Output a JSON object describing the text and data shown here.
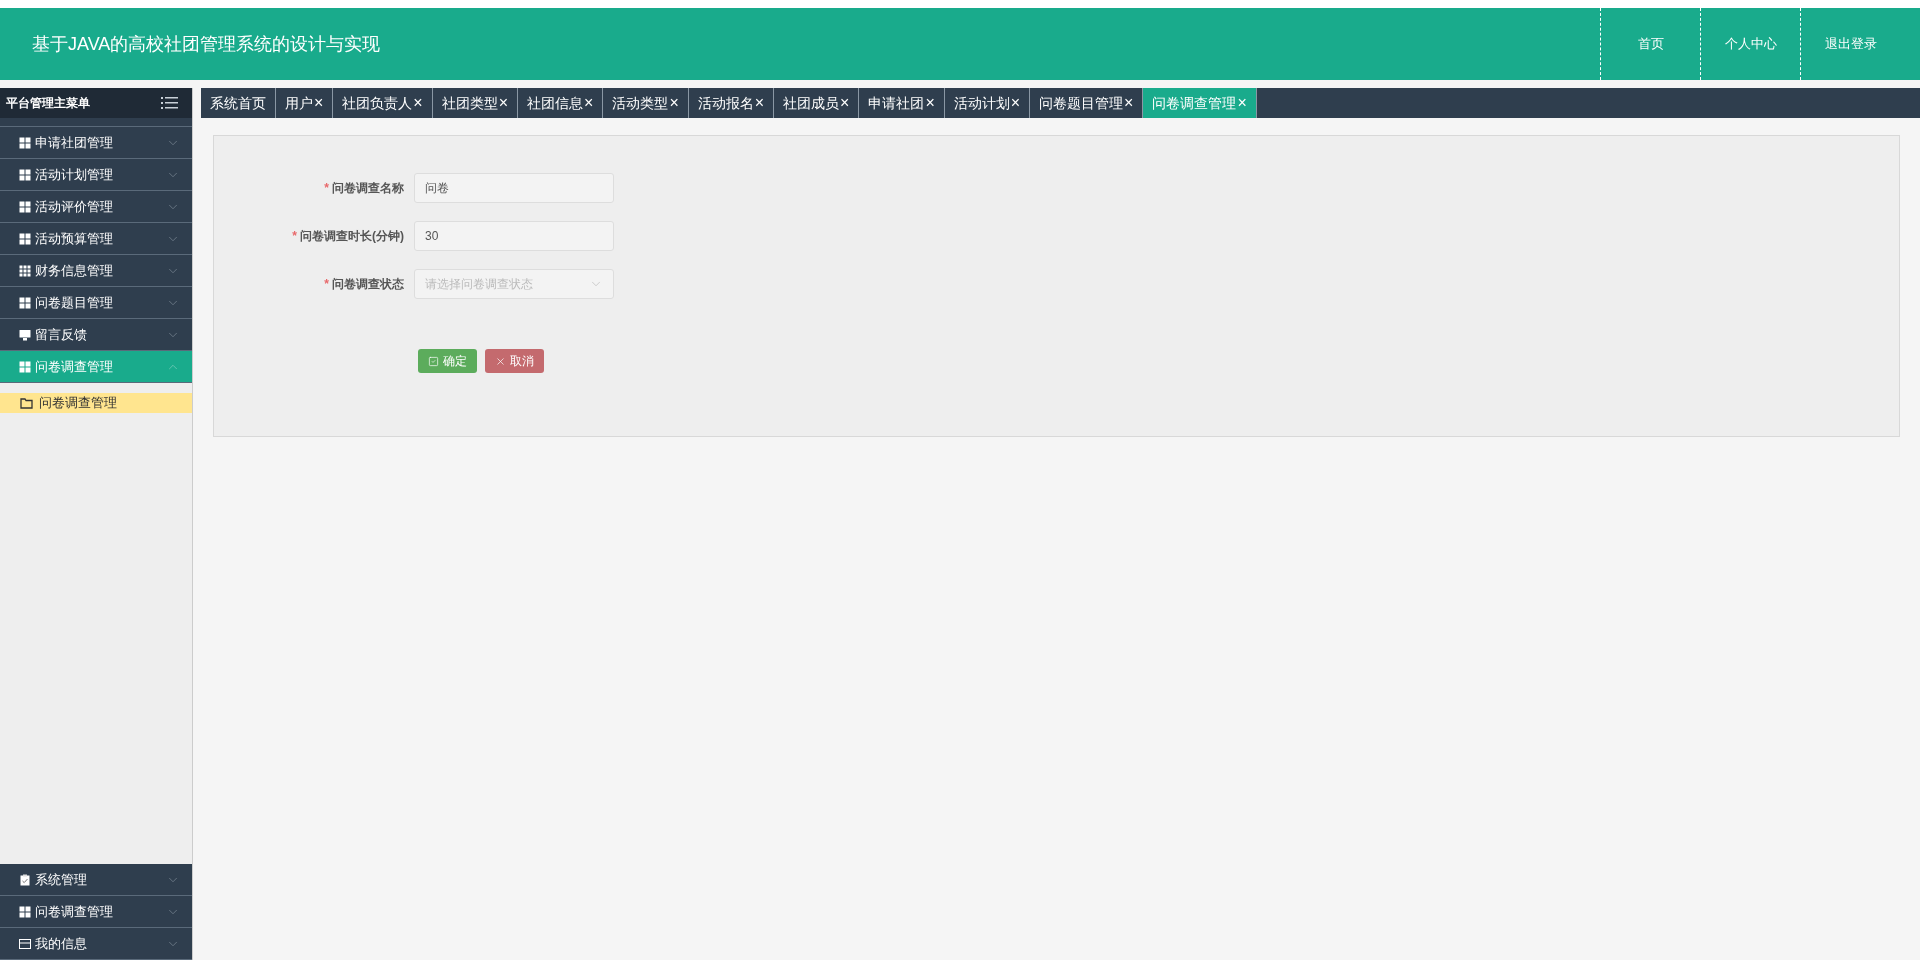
{
  "header": {
    "title": "基于JAVA的高校社团管理系统的设计与实现",
    "nav": [
      {
        "label": "首页"
      },
      {
        "label": "个人中心"
      },
      {
        "label": "退出登录"
      }
    ]
  },
  "sidebar": {
    "title": "平台管理主菜单",
    "items": [
      {
        "label": "申请社团管理",
        "kind": "grid",
        "expanded": false
      },
      {
        "label": "活动计划管理",
        "kind": "grid",
        "expanded": false
      },
      {
        "label": "活动评价管理",
        "kind": "grid",
        "expanded": false
      },
      {
        "label": "活动预算管理",
        "kind": "grid",
        "expanded": false
      },
      {
        "label": "财务信息管理",
        "kind": "table",
        "expanded": false
      },
      {
        "label": "问卷题目管理",
        "kind": "grid",
        "expanded": false
      },
      {
        "label": "留言反馈",
        "kind": "monitor",
        "expanded": false
      },
      {
        "label": "问卷调查管理",
        "kind": "grid",
        "expanded": true,
        "children": [
          {
            "label": "问卷调查管理",
            "selected": true
          }
        ]
      }
    ],
    "bottom_items": [
      {
        "label": "系统管理",
        "kind": "clipboard",
        "expanded": false
      },
      {
        "label": "问卷调查管理",
        "kind": "grid",
        "expanded": false
      },
      {
        "label": "我的信息",
        "kind": "card",
        "expanded": false
      }
    ]
  },
  "tabs": [
    {
      "label": "系统首页",
      "selected": false
    },
    {
      "label": "用户",
      "close": "×",
      "selected": false
    },
    {
      "label": "社团负责人",
      "close": "×",
      "selected": false
    },
    {
      "label": "社团类型",
      "close": "×",
      "selected": false
    },
    {
      "label": "社团信息",
      "close": "×",
      "selected": false
    },
    {
      "label": "活动类型",
      "close": "×",
      "selected": false
    },
    {
      "label": "活动报名",
      "close": "×",
      "selected": false
    },
    {
      "label": "社团成员",
      "close": "×",
      "selected": false
    },
    {
      "label": "申请社团",
      "close": "×",
      "selected": false
    },
    {
      "label": "活动计划",
      "close": "×",
      "selected": false
    },
    {
      "label": "问卷题目管理",
      "close": "×",
      "selected": false
    },
    {
      "label": "问卷调查管理",
      "close": "×",
      "selected": true
    }
  ],
  "form": {
    "fields": [
      {
        "kind": "input",
        "required": "*",
        "label": "问卷调查名称",
        "value": "问卷"
      },
      {
        "kind": "input",
        "required": "*",
        "label": "问卷调查时长(分钟)",
        "value": "30"
      },
      {
        "kind": "select",
        "required": "*",
        "label": "问卷调查状态",
        "placeholder": "请选择问卷调查状态"
      }
    ],
    "buttons": [
      {
        "kind": "confirm",
        "label": "确定"
      },
      {
        "kind": "cancel",
        "label": "取消"
      }
    ]
  }
}
